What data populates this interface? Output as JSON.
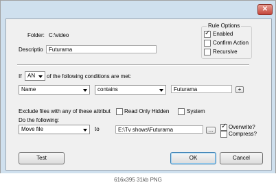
{
  "window": {
    "close_symbol": "✕"
  },
  "folder": {
    "label": "Folder:",
    "path": "C:\\video"
  },
  "description": {
    "label": "Descriptio",
    "value": "Futurama"
  },
  "rule_options": {
    "title": "Rule Options",
    "enabled": {
      "label": "Enabled",
      "checked": true
    },
    "confirm": {
      "label": "Confirm Action",
      "checked": false
    },
    "recursive": {
      "label": "Recursive",
      "checked": false
    }
  },
  "conditions": {
    "prefix": "If",
    "match_mode": "AN",
    "suffix": "of the following conditions are met:",
    "field": "Name",
    "operator": "contains",
    "value": "Futurama",
    "add_symbol": "+"
  },
  "exclude": {
    "label": "Exclude files with any of these attribut",
    "read_only": {
      "label": "Read Only",
      "checked": false
    },
    "hidden": {
      "label": "Hidden",
      "checked": false
    },
    "system": {
      "label": "System",
      "checked": false
    }
  },
  "action": {
    "label": "Do the following:",
    "type": "Move file",
    "to_label": "to",
    "destination": "E:\\Tv shows\\Futurama",
    "browse_label": "...",
    "overwrite": {
      "label": "Overwrite?",
      "checked": true
    },
    "compress": {
      "label": "Compress?",
      "checked": false
    }
  },
  "buttons": {
    "test": "Test",
    "ok": "OK",
    "cancel": "Cancel"
  },
  "caption": "616x395 31kb PNG"
}
